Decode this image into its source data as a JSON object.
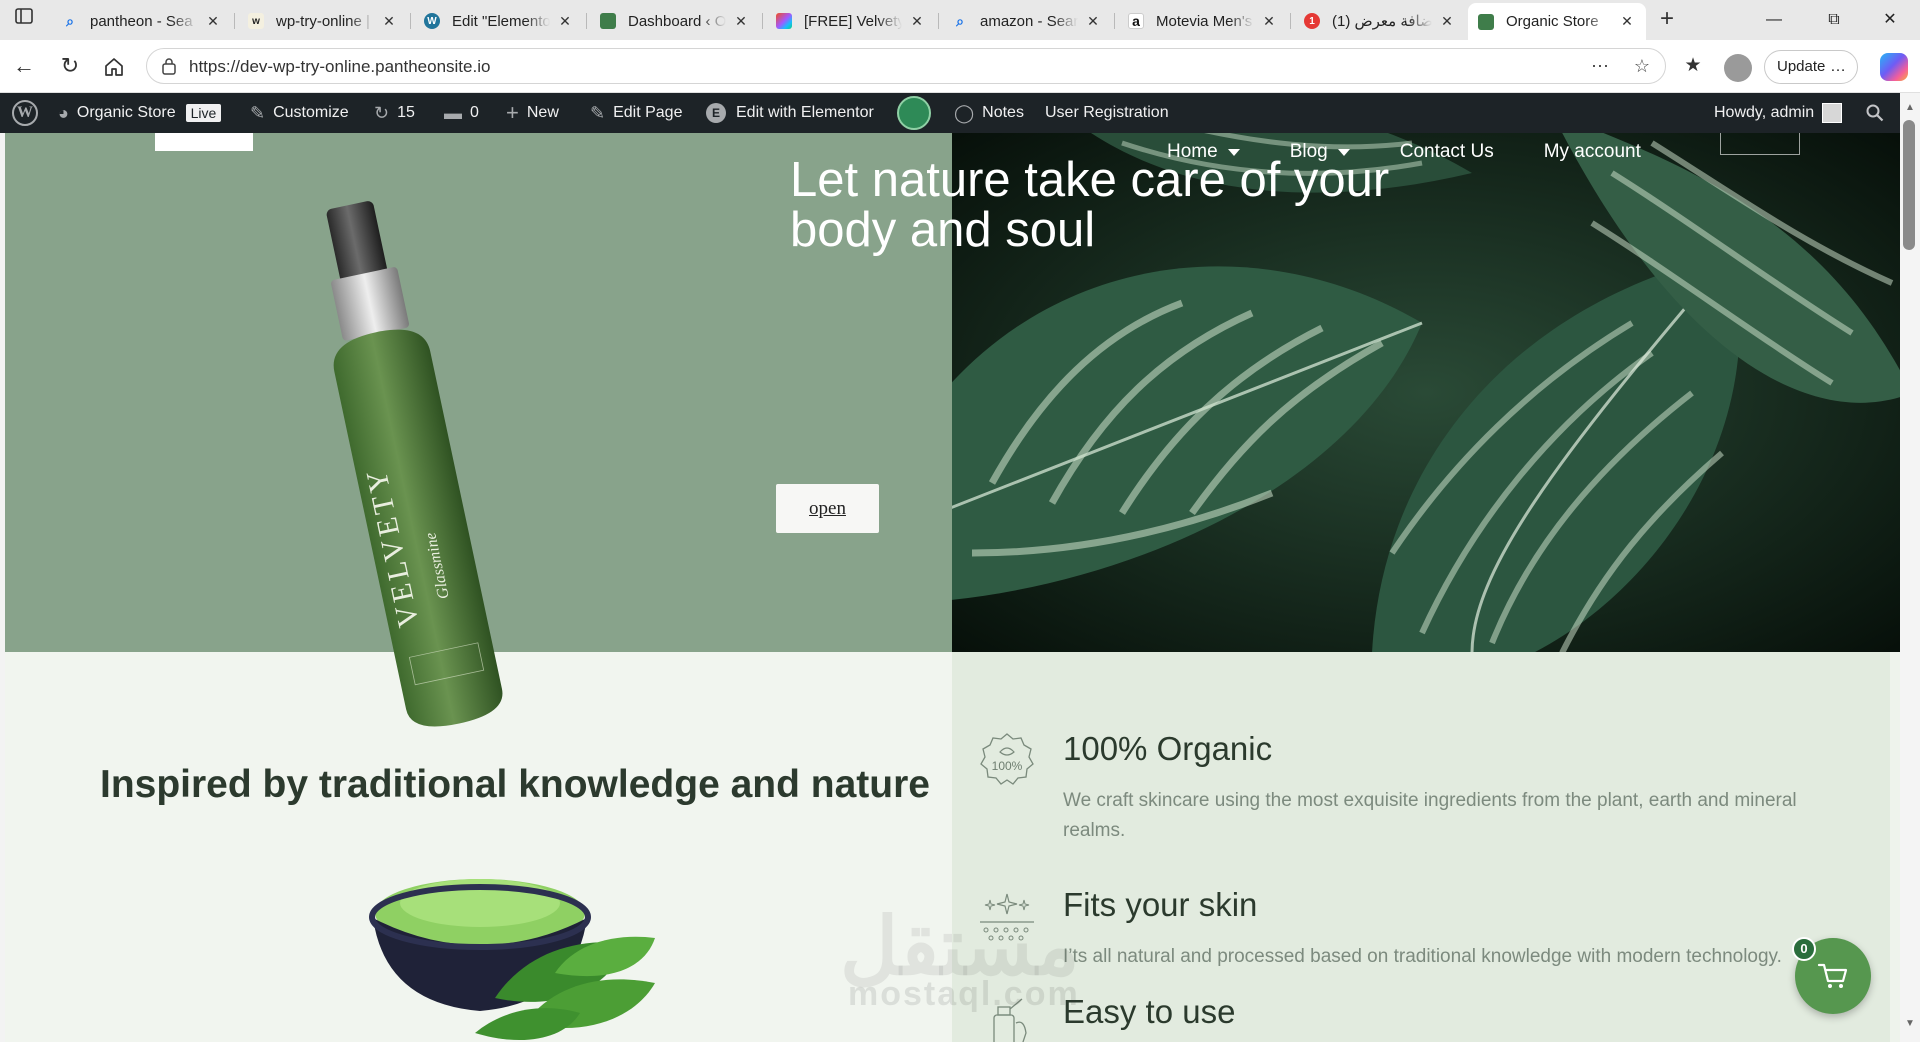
{
  "browser": {
    "tabs": [
      {
        "title": "pantheon - Sea",
        "favicon": "search-icon",
        "color": "#1a73e8"
      },
      {
        "title": "wp-try-online |",
        "favicon": "wp-try-icon",
        "color": "#1f1f1f"
      },
      {
        "title": "Edit \"Elementor",
        "favicon": "wordpress-icon",
        "color": "#21759b"
      },
      {
        "title": "Dashboard ‹ Or",
        "favicon": "organic-store-icon",
        "color": "#3f7d4a"
      },
      {
        "title": "[FREE] Velvety",
        "favicon": "figma-icon",
        "color": "#f24e1e"
      },
      {
        "title": "amazon - Sear",
        "favicon": "search-icon",
        "color": "#1a73e8"
      },
      {
        "title": "Motevia Men's",
        "favicon": "amazon-icon",
        "color": "#111111"
      },
      {
        "title": "(1) إضافة معرض",
        "favicon": "mostaql-icon",
        "color": "#e53935"
      },
      {
        "title": "Organic Store",
        "favicon": "organic-store-icon",
        "color": "#3f7d4a",
        "active": true
      }
    ],
    "url": "https://dev-wp-try-online.pantheonsite.io",
    "update_label": "Update"
  },
  "adminbar": {
    "site_name": "Organic Store",
    "live_badge": "Live",
    "customize": "Customize",
    "updates_count": "15",
    "comments_count": "0",
    "new_label": "New",
    "edit_page": "Edit Page",
    "edit_elementor": "Edit with Elementor",
    "notes": "Notes",
    "user_registration": "User Registration",
    "howdy": "Howdy, admin"
  },
  "site_nav": {
    "items": [
      {
        "label": "Home",
        "has_dropdown": true
      },
      {
        "label": "Blog",
        "has_dropdown": true
      },
      {
        "label": "Contact Us",
        "has_dropdown": false
      },
      {
        "label": "My account",
        "has_dropdown": false
      }
    ]
  },
  "hero": {
    "title_line1": "Let nature take care of your",
    "title_line2": "body and soul",
    "button_label": "open",
    "bottle_brand": "VELVETY",
    "bottle_sub": "Glassmine"
  },
  "section": {
    "title": "Inspired by traditional knowledge and nature"
  },
  "features": [
    {
      "title": "100% Organic",
      "desc": "We craft skincare using the most exquisite ingredients from the plant, earth and mineral realms.",
      "icon": "organic-badge-icon",
      "badge_text": "100%"
    },
    {
      "title": "Fits your skin",
      "desc": "I’ts all natural and processed based on traditional knowledge with modern technology.",
      "icon": "sparkle-icon"
    },
    {
      "title": "Easy to use",
      "desc": "",
      "icon": "bottle-icon"
    }
  ],
  "cart": {
    "count": "0"
  },
  "watermark": {
    "text": "مستقل",
    "sub": "mostaql.com"
  },
  "colors": {
    "admin_bar": "#1d2327",
    "hero_left": "#88a38b",
    "feature_panel": "#e2ebdf",
    "cart_button": "#56974f"
  }
}
